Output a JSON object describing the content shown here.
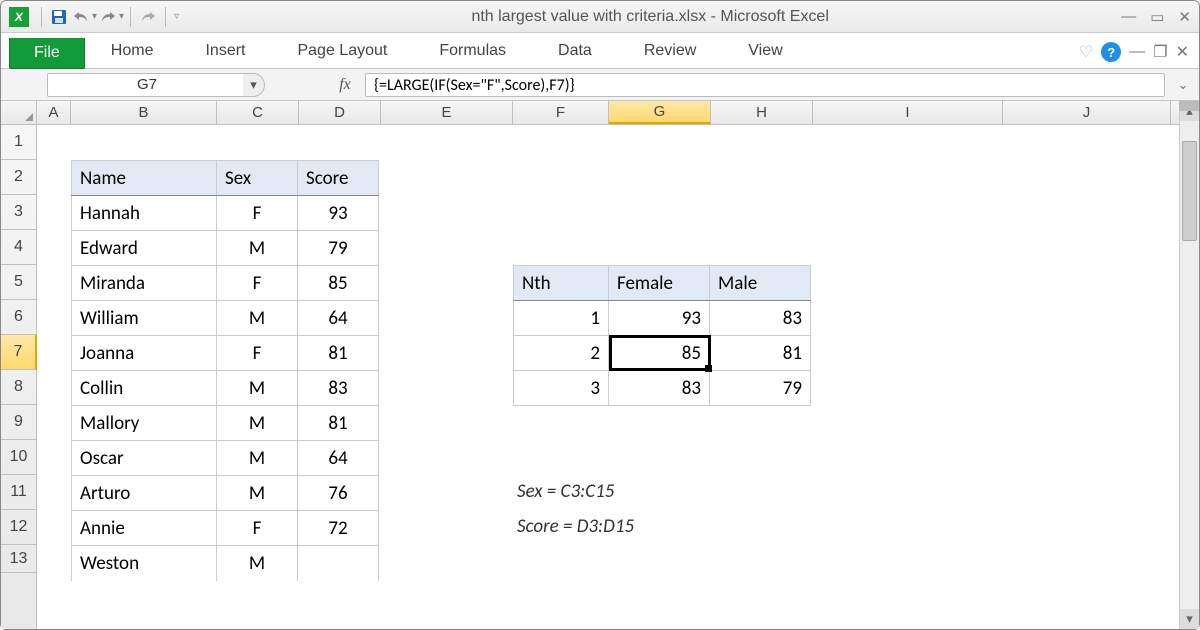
{
  "title": "nth largest value with criteria.xlsx  -  Microsoft Excel",
  "ribbon": {
    "file": "File",
    "home": "Home",
    "insert": "Insert",
    "page_layout": "Page Layout",
    "formulas": "Formulas",
    "data": "Data",
    "review": "Review",
    "view": "View"
  },
  "namebox": "G7",
  "formula": "{=LARGE(IF(Sex=\"F\",Score),F7)}",
  "columns": [
    "A",
    "B",
    "C",
    "D",
    "E",
    "F",
    "G",
    "H",
    "I",
    "J"
  ],
  "rows": [
    "1",
    "2",
    "3",
    "4",
    "5",
    "6",
    "7",
    "8",
    "9",
    "10",
    "11",
    "12",
    "13"
  ],
  "selected_col": "G",
  "selected_row": "7",
  "main_table": {
    "headers": [
      "Name",
      "Sex",
      "Score"
    ],
    "rows": [
      {
        "name": "Hannah",
        "sex": "F",
        "score": 93
      },
      {
        "name": "Edward",
        "sex": "M",
        "score": 79
      },
      {
        "name": "Miranda",
        "sex": "F",
        "score": 85
      },
      {
        "name": "William",
        "sex": "M",
        "score": 64
      },
      {
        "name": "Joanna",
        "sex": "F",
        "score": 81
      },
      {
        "name": "Collin",
        "sex": "M",
        "score": 83
      },
      {
        "name": "Mallory",
        "sex": "M",
        "score": 81
      },
      {
        "name": "Oscar",
        "sex": "M",
        "score": 64
      },
      {
        "name": "Arturo",
        "sex": "M",
        "score": 76
      },
      {
        "name": "Annie",
        "sex": "F",
        "score": 72
      },
      {
        "name": "Weston",
        "sex": "M",
        "score": ""
      }
    ]
  },
  "side_table": {
    "headers": [
      "Nth",
      "Female",
      "Male"
    ],
    "rows": [
      {
        "n": 1,
        "f": 93,
        "m": 83
      },
      {
        "n": 2,
        "f": 85,
        "m": 81
      },
      {
        "n": 3,
        "f": 83,
        "m": 79
      }
    ]
  },
  "notes": {
    "l1": "Sex = C3:C15",
    "l2": "Score = D3:D15"
  }
}
